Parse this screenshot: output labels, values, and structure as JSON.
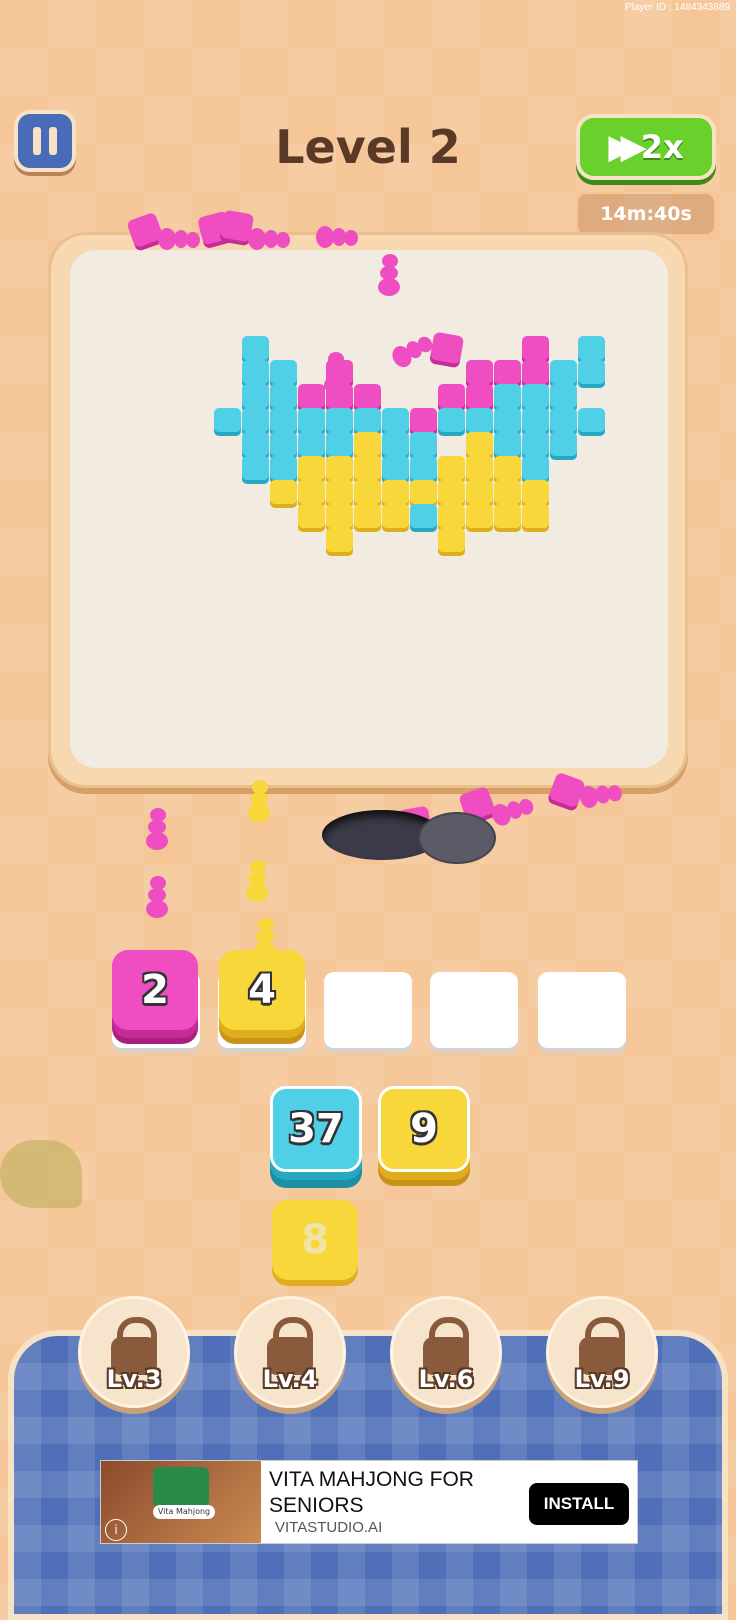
{
  "player_id": "Player ID : 1484343889",
  "level_title": "Level 2",
  "speed_label": "2x",
  "timer": "14m:40s",
  "colors": {
    "cyan": "#4fd0e6",
    "magenta": "#ef4dc2",
    "yellow": "#f8d73a",
    "green": "#6ad12c",
    "blue_panel": "#4f6fb8"
  },
  "slots": [
    {
      "count": "2",
      "color": "magenta"
    },
    {
      "count": "4",
      "color": "yellow"
    },
    {
      "count": "",
      "color": "empty"
    },
    {
      "count": "",
      "color": "empty"
    },
    {
      "count": "",
      "color": "empty"
    }
  ],
  "queue": [
    {
      "count": "37",
      "color": "cyan"
    },
    {
      "count": "9",
      "color": "yellow"
    },
    {
      "count": "8",
      "color": "yellow",
      "state": "dimmed"
    }
  ],
  "locked_boosters": [
    {
      "label": "Lv.3",
      "icon": "lock-icon"
    },
    {
      "label": "Lv.4",
      "icon": "lock-icon"
    },
    {
      "label": "Lv.6",
      "icon": "lock-icon"
    },
    {
      "label": "Lv.9",
      "icon": "lock-icon"
    }
  ],
  "ad": {
    "title": "VITA MAHJONG FOR SENIORS",
    "domain": "VITASTUDIO.AI",
    "button": "INSTALL",
    "app_name": "Vita Mahjong",
    "info_icon": "i"
  }
}
